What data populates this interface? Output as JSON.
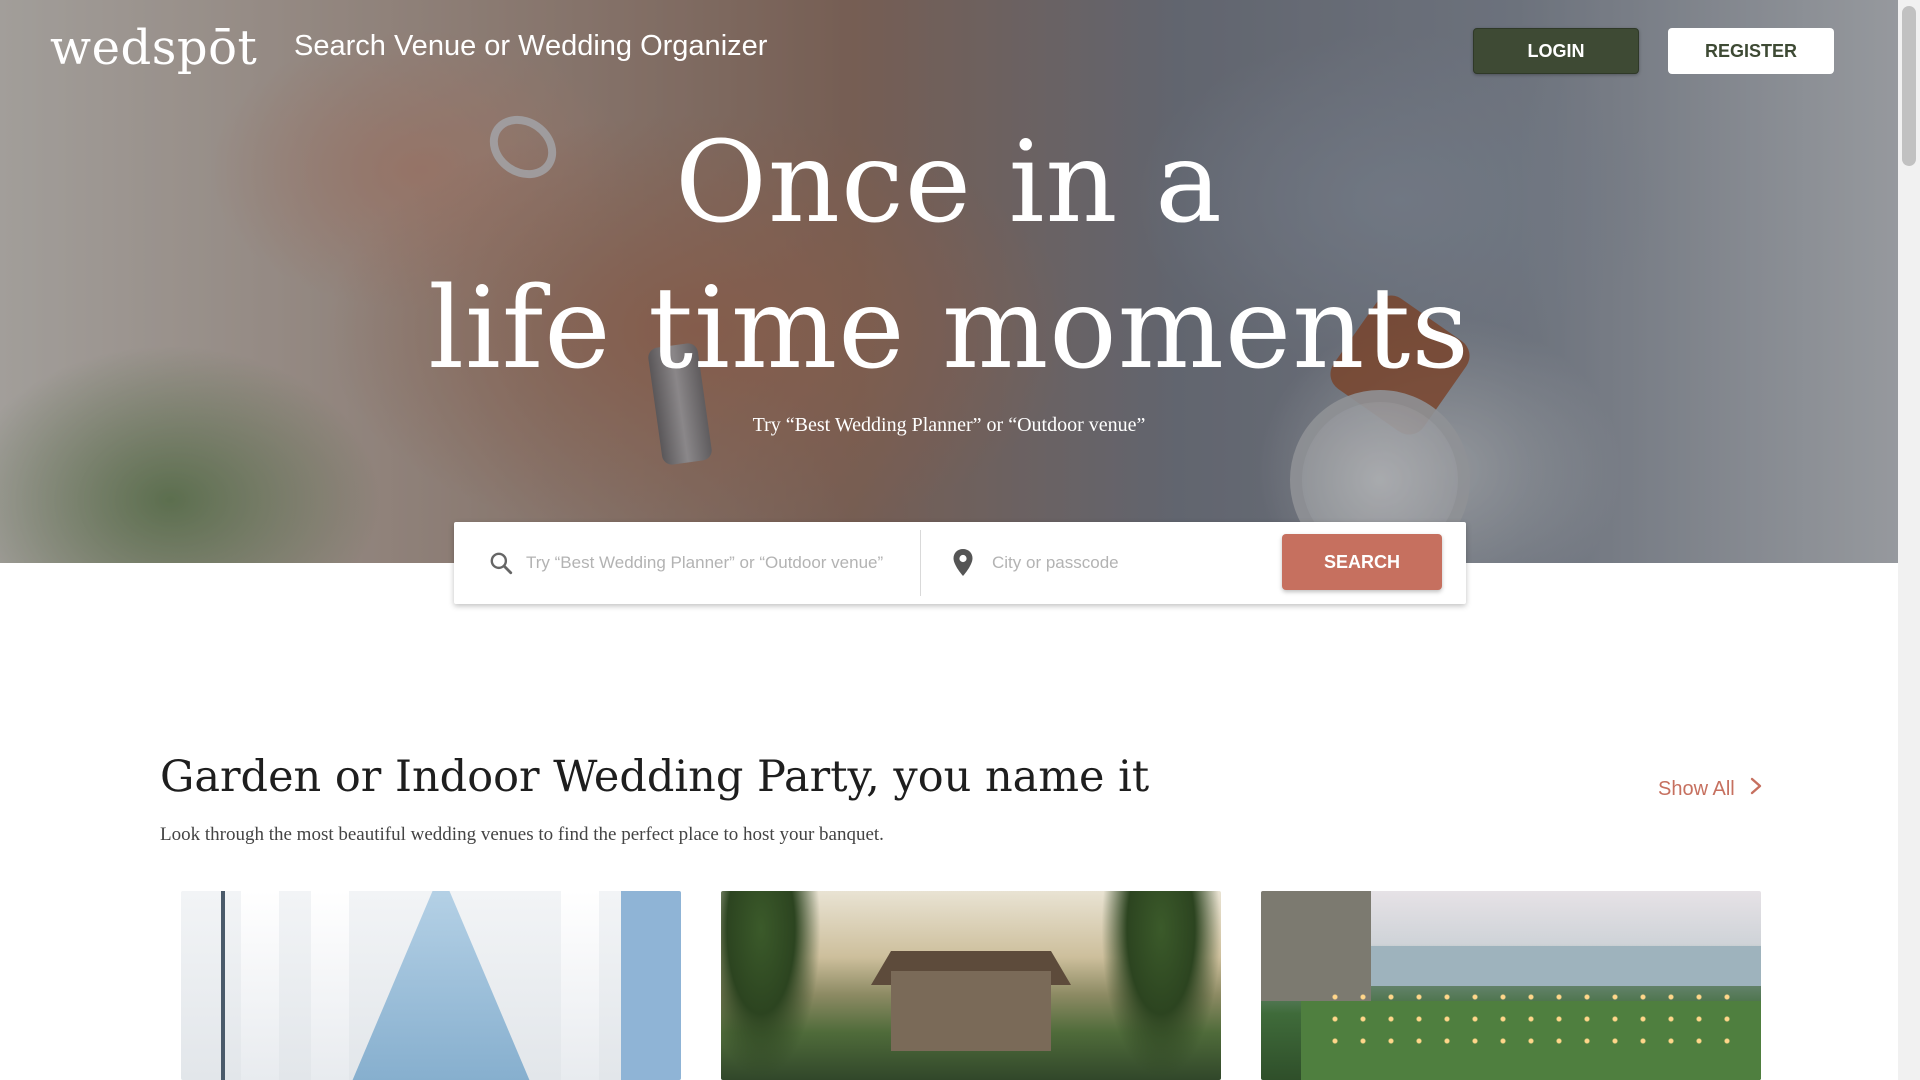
{
  "header": {
    "logo_text": "wedspōt",
    "nav_search_label": "Search Venue or Wedding Organizer",
    "login_label": "LOGIN",
    "register_label": "REGISTER"
  },
  "hero": {
    "title_line1": "Once in a",
    "title_line2": "life time moments",
    "subtitle": "Try “Best Wedding Planner” or “Outdoor venue”"
  },
  "search": {
    "keyword_placeholder": "Try “Best Wedding Planner” or “Outdoor venue”",
    "location_placeholder": "City or passcode",
    "button_label": "SEARCH",
    "search_icon": "search-icon",
    "location_icon": "location-pin-icon"
  },
  "section": {
    "title": "Garden or Indoor Wedding Party, you name it",
    "description": "Look through the most beautiful wedding venues to find the perfect place to host your banquet.",
    "show_all_label": "Show All",
    "show_all_icon": "chevron-right-icon"
  },
  "venues": [
    {
      "image": "white-chapel-photo"
    },
    {
      "image": "tropical-resort-photo"
    },
    {
      "image": "seaside-garden-photo"
    }
  ],
  "colors": {
    "accent": "#c6705f",
    "login_bg": "#3e4a34",
    "text_dark": "#1e1e1e"
  }
}
